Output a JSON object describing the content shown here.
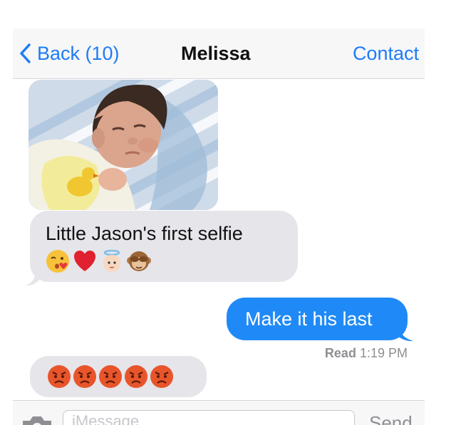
{
  "nav": {
    "back_label": "Back (10)",
    "title": "Melissa",
    "contact_label": "Contact",
    "back_icon": "chevron-left-icon"
  },
  "messages": [
    {
      "direction": "incoming",
      "type": "photo",
      "photo_subject": "photo-of-baby-in-blanket"
    },
    {
      "direction": "incoming",
      "text": "Little Jason's first selfie",
      "emojis": [
        "kissing-face-emoji",
        "red-heart-emoji",
        "angel-face-emoji",
        "monkey-emoji"
      ]
    },
    {
      "direction": "outgoing",
      "text": "Make it his last",
      "receipt_label": "Read",
      "receipt_time": "1:19 PM"
    },
    {
      "direction": "incoming",
      "emojis": [
        "angry-face-emoji",
        "angry-face-emoji",
        "angry-face-emoji",
        "angry-face-emoji",
        "angry-face-emoji"
      ]
    }
  ],
  "composer": {
    "camera_icon": "camera-icon",
    "placeholder": "iMessage",
    "send_label": "Send"
  },
  "colors": {
    "ios_blue": "#1e7cf5",
    "bubble_out": "#1f8af7",
    "bubble_in": "#e5e5ea",
    "receipt_gray": "#8e8e93"
  }
}
